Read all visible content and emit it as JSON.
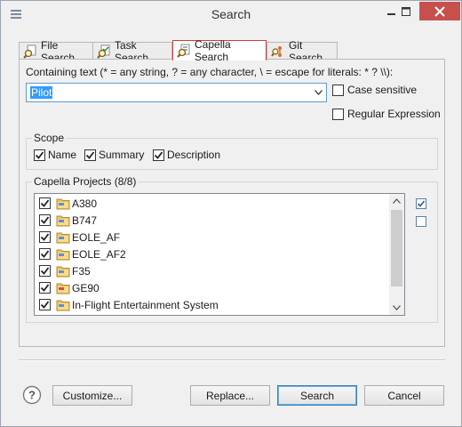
{
  "window": {
    "title": "Search"
  },
  "tabs": [
    {
      "label": "File Search",
      "icon": "file-search-icon",
      "active": false
    },
    {
      "label": "Task Search",
      "icon": "task-search-icon",
      "active": false
    },
    {
      "label": "Capella Search",
      "icon": "capella-search-icon",
      "active": true
    },
    {
      "label": "Git Search",
      "icon": "git-search-icon",
      "active": false
    }
  ],
  "search": {
    "containing_label": "Containing text (* = any string, ? = any character, \\ = escape for literals: * ? \\\\):",
    "value": "Pilot",
    "case_sensitive": {
      "label": "Case sensitive",
      "checked": false
    },
    "regex": {
      "label": "Regular Expression",
      "checked": false
    }
  },
  "scope": {
    "title": "Scope",
    "items": [
      {
        "label": "Name",
        "checked": true
      },
      {
        "label": "Summary",
        "checked": true
      },
      {
        "label": "Description",
        "checked": true
      }
    ]
  },
  "projects": {
    "title": "Capella Projects (8/8)",
    "items": [
      {
        "label": "A380",
        "checked": true
      },
      {
        "label": "B747",
        "checked": true
      },
      {
        "label": "EOLE_AF",
        "checked": true
      },
      {
        "label": "EOLE_AF2",
        "checked": true
      },
      {
        "label": "F35",
        "checked": true
      },
      {
        "label": "GE90",
        "checked": true
      },
      {
        "label": "In-Flight Entertainment System",
        "checked": true
      }
    ]
  },
  "buttons": {
    "customize": "Customize...",
    "replace": "Replace...",
    "search": "Search",
    "cancel": "Cancel"
  },
  "colors": {
    "accent": "#3399ff",
    "active_tab_border": "#d23b3b",
    "close_button": "#c7504c"
  }
}
